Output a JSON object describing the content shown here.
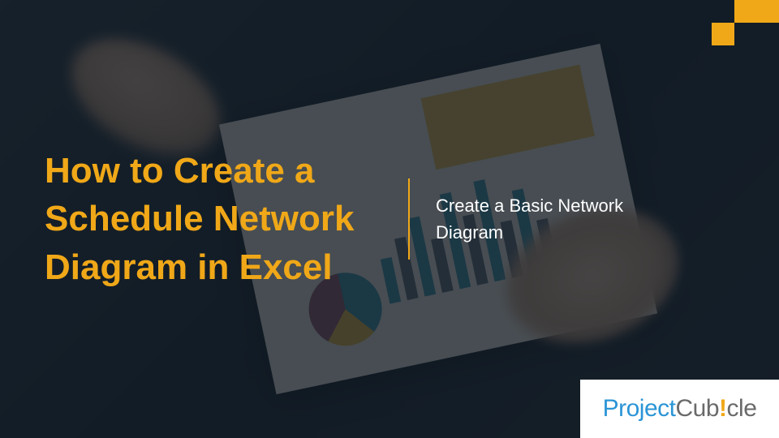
{
  "title": "How to Create a Schedule Network Diagram in Excel",
  "subtitle": "Create a Basic Network Diagram",
  "logo": {
    "part1": "Project",
    "part2": "Cub",
    "part3": "!",
    "part4": "cle"
  },
  "accent_color": "#f0a818",
  "brand_blue": "#2b95d6"
}
